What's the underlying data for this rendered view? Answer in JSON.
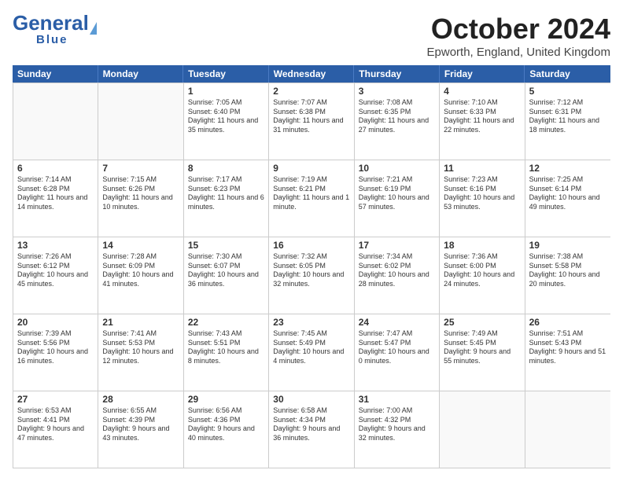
{
  "header": {
    "logo_general": "General",
    "logo_blue": "Blue",
    "month_title": "October 2024",
    "location": "Epworth, England, United Kingdom"
  },
  "days_of_week": [
    "Sunday",
    "Monday",
    "Tuesday",
    "Wednesday",
    "Thursday",
    "Friday",
    "Saturday"
  ],
  "weeks": [
    [
      {
        "day": "",
        "sunrise": "",
        "sunset": "",
        "daylight": "",
        "empty": true
      },
      {
        "day": "",
        "sunrise": "",
        "sunset": "",
        "daylight": "",
        "empty": true
      },
      {
        "day": "1",
        "sunrise": "Sunrise: 7:05 AM",
        "sunset": "Sunset: 6:40 PM",
        "daylight": "Daylight: 11 hours and 35 minutes."
      },
      {
        "day": "2",
        "sunrise": "Sunrise: 7:07 AM",
        "sunset": "Sunset: 6:38 PM",
        "daylight": "Daylight: 11 hours and 31 minutes."
      },
      {
        "day": "3",
        "sunrise": "Sunrise: 7:08 AM",
        "sunset": "Sunset: 6:35 PM",
        "daylight": "Daylight: 11 hours and 27 minutes."
      },
      {
        "day": "4",
        "sunrise": "Sunrise: 7:10 AM",
        "sunset": "Sunset: 6:33 PM",
        "daylight": "Daylight: 11 hours and 22 minutes."
      },
      {
        "day": "5",
        "sunrise": "Sunrise: 7:12 AM",
        "sunset": "Sunset: 6:31 PM",
        "daylight": "Daylight: 11 hours and 18 minutes."
      }
    ],
    [
      {
        "day": "6",
        "sunrise": "Sunrise: 7:14 AM",
        "sunset": "Sunset: 6:28 PM",
        "daylight": "Daylight: 11 hours and 14 minutes."
      },
      {
        "day": "7",
        "sunrise": "Sunrise: 7:15 AM",
        "sunset": "Sunset: 6:26 PM",
        "daylight": "Daylight: 11 hours and 10 minutes."
      },
      {
        "day": "8",
        "sunrise": "Sunrise: 7:17 AM",
        "sunset": "Sunset: 6:23 PM",
        "daylight": "Daylight: 11 hours and 6 minutes."
      },
      {
        "day": "9",
        "sunrise": "Sunrise: 7:19 AM",
        "sunset": "Sunset: 6:21 PM",
        "daylight": "Daylight: 11 hours and 1 minute."
      },
      {
        "day": "10",
        "sunrise": "Sunrise: 7:21 AM",
        "sunset": "Sunset: 6:19 PM",
        "daylight": "Daylight: 10 hours and 57 minutes."
      },
      {
        "day": "11",
        "sunrise": "Sunrise: 7:23 AM",
        "sunset": "Sunset: 6:16 PM",
        "daylight": "Daylight: 10 hours and 53 minutes."
      },
      {
        "day": "12",
        "sunrise": "Sunrise: 7:25 AM",
        "sunset": "Sunset: 6:14 PM",
        "daylight": "Daylight: 10 hours and 49 minutes."
      }
    ],
    [
      {
        "day": "13",
        "sunrise": "Sunrise: 7:26 AM",
        "sunset": "Sunset: 6:12 PM",
        "daylight": "Daylight: 10 hours and 45 minutes."
      },
      {
        "day": "14",
        "sunrise": "Sunrise: 7:28 AM",
        "sunset": "Sunset: 6:09 PM",
        "daylight": "Daylight: 10 hours and 41 minutes."
      },
      {
        "day": "15",
        "sunrise": "Sunrise: 7:30 AM",
        "sunset": "Sunset: 6:07 PM",
        "daylight": "Daylight: 10 hours and 36 minutes."
      },
      {
        "day": "16",
        "sunrise": "Sunrise: 7:32 AM",
        "sunset": "Sunset: 6:05 PM",
        "daylight": "Daylight: 10 hours and 32 minutes."
      },
      {
        "day": "17",
        "sunrise": "Sunrise: 7:34 AM",
        "sunset": "Sunset: 6:02 PM",
        "daylight": "Daylight: 10 hours and 28 minutes."
      },
      {
        "day": "18",
        "sunrise": "Sunrise: 7:36 AM",
        "sunset": "Sunset: 6:00 PM",
        "daylight": "Daylight: 10 hours and 24 minutes."
      },
      {
        "day": "19",
        "sunrise": "Sunrise: 7:38 AM",
        "sunset": "Sunset: 5:58 PM",
        "daylight": "Daylight: 10 hours and 20 minutes."
      }
    ],
    [
      {
        "day": "20",
        "sunrise": "Sunrise: 7:39 AM",
        "sunset": "Sunset: 5:56 PM",
        "daylight": "Daylight: 10 hours and 16 minutes."
      },
      {
        "day": "21",
        "sunrise": "Sunrise: 7:41 AM",
        "sunset": "Sunset: 5:53 PM",
        "daylight": "Daylight: 10 hours and 12 minutes."
      },
      {
        "day": "22",
        "sunrise": "Sunrise: 7:43 AM",
        "sunset": "Sunset: 5:51 PM",
        "daylight": "Daylight: 10 hours and 8 minutes."
      },
      {
        "day": "23",
        "sunrise": "Sunrise: 7:45 AM",
        "sunset": "Sunset: 5:49 PM",
        "daylight": "Daylight: 10 hours and 4 minutes."
      },
      {
        "day": "24",
        "sunrise": "Sunrise: 7:47 AM",
        "sunset": "Sunset: 5:47 PM",
        "daylight": "Daylight: 10 hours and 0 minutes."
      },
      {
        "day": "25",
        "sunrise": "Sunrise: 7:49 AM",
        "sunset": "Sunset: 5:45 PM",
        "daylight": "Daylight: 9 hours and 55 minutes."
      },
      {
        "day": "26",
        "sunrise": "Sunrise: 7:51 AM",
        "sunset": "Sunset: 5:43 PM",
        "daylight": "Daylight: 9 hours and 51 minutes."
      }
    ],
    [
      {
        "day": "27",
        "sunrise": "Sunrise: 6:53 AM",
        "sunset": "Sunset: 4:41 PM",
        "daylight": "Daylight: 9 hours and 47 minutes."
      },
      {
        "day": "28",
        "sunrise": "Sunrise: 6:55 AM",
        "sunset": "Sunset: 4:39 PM",
        "daylight": "Daylight: 9 hours and 43 minutes."
      },
      {
        "day": "29",
        "sunrise": "Sunrise: 6:56 AM",
        "sunset": "Sunset: 4:36 PM",
        "daylight": "Daylight: 9 hours and 40 minutes."
      },
      {
        "day": "30",
        "sunrise": "Sunrise: 6:58 AM",
        "sunset": "Sunset: 4:34 PM",
        "daylight": "Daylight: 9 hours and 36 minutes."
      },
      {
        "day": "31",
        "sunrise": "Sunrise: 7:00 AM",
        "sunset": "Sunset: 4:32 PM",
        "daylight": "Daylight: 9 hours and 32 minutes."
      },
      {
        "day": "",
        "sunrise": "",
        "sunset": "",
        "daylight": "",
        "empty": true
      },
      {
        "day": "",
        "sunrise": "",
        "sunset": "",
        "daylight": "",
        "empty": true
      }
    ]
  ]
}
